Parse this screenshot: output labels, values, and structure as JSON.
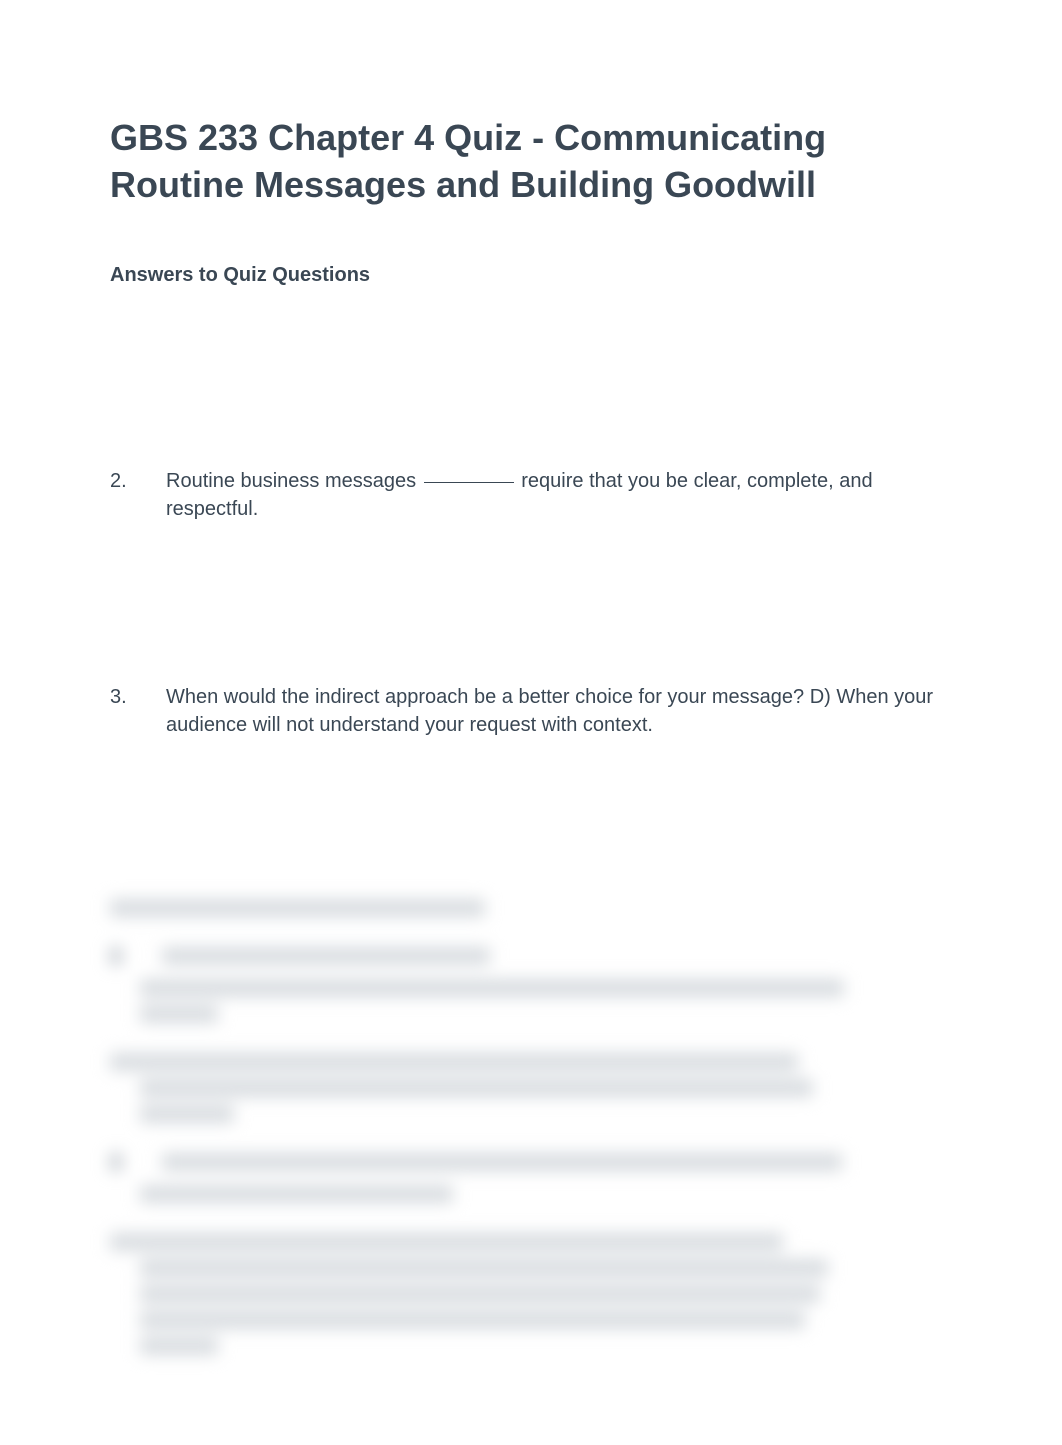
{
  "title": "GBS 233 Chapter 4 Quiz - Communicating Routine Messages and Building Goodwill",
  "subtitle": "Answers to Quiz Questions",
  "questions": [
    {
      "number": "2.",
      "text_before": "Routine business messages ",
      "text_after": " require that you be clear, complete, and respectful.",
      "has_blank": true
    },
    {
      "number": "3.",
      "text": "When would the indirect approach be a better choice for your message? D) When your audience will not understand your request with context.",
      "has_blank": false
    }
  ]
}
